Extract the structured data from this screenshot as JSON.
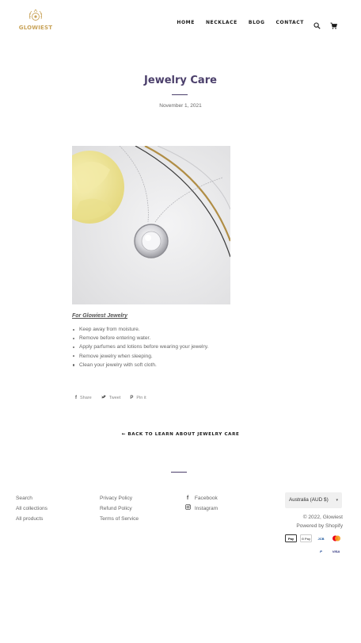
{
  "header": {
    "logo_text": "GLOWIEST",
    "nav": [
      {
        "label": "HOME"
      },
      {
        "label": "NECKLACE"
      },
      {
        "label": "BLOG"
      },
      {
        "label": "CONTACT"
      }
    ],
    "icons": [
      "search-icon",
      "cart-icon"
    ]
  },
  "article": {
    "title": "Jewelry Care",
    "date": "November 1, 2021",
    "subheading": "For Glowiest Jewelry",
    "care_items": [
      "Keep away from moisture.",
      "Remove before entering water.",
      "Apply parfumes and lotions before wearing your jewelry.",
      "Remove jewelry when sleeping.",
      "Clean your jewelry with soft cloth."
    ],
    "share": {
      "share": "Share",
      "tweet": "Tweet",
      "pin": "Pin it"
    },
    "back_link": "← BACK TO LEARN ABOUT JEWELRY CARE"
  },
  "footer": {
    "col1": [
      "Search",
      "All collections",
      "All products"
    ],
    "col2": [
      "Privacy Policy",
      "Refund Policy",
      "Terms of Service"
    ],
    "social": [
      {
        "label": "Facebook",
        "icon": "facebook-icon"
      },
      {
        "label": "Instagram",
        "icon": "instagram-icon"
      }
    ],
    "currency": "Australia (AUD $)",
    "copyright": "© 2022, Glowiest",
    "powered": "Powered by Shopify",
    "payments": [
      "Pay",
      "G Pay",
      "JCB",
      "",
      "P",
      "VISA"
    ]
  },
  "colors": {
    "brand_gold": "#c9a45a",
    "title_purple": "#4b3f6b"
  }
}
